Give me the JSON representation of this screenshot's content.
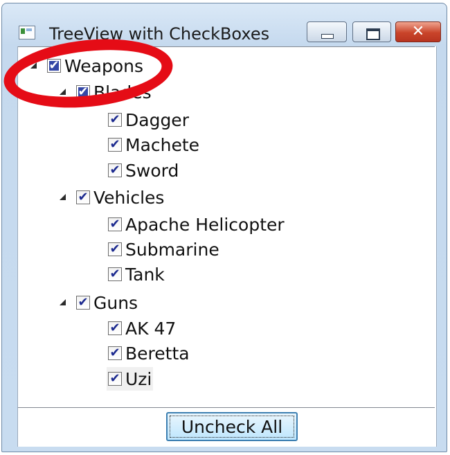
{
  "window": {
    "title": "TreeView with CheckBoxes",
    "controls": {
      "minimize": "",
      "maximize": "",
      "close": "✕"
    }
  },
  "tree": {
    "root": {
      "label": "Weapons",
      "checked": true,
      "expanded": true
    },
    "groups": [
      {
        "label": "Blades",
        "checked": true,
        "expanded": true,
        "items": [
          {
            "label": "Dagger",
            "checked": true
          },
          {
            "label": "Machete",
            "checked": true
          },
          {
            "label": "Sword",
            "checked": true
          }
        ]
      },
      {
        "label": "Vehicles",
        "checked": true,
        "expanded": true,
        "items": [
          {
            "label": "Apache Helicopter",
            "checked": true
          },
          {
            "label": "Submarine",
            "checked": true
          },
          {
            "label": "Tank",
            "checked": true
          }
        ]
      },
      {
        "label": "Guns",
        "checked": true,
        "expanded": true,
        "items": [
          {
            "label": "AK 47",
            "checked": true
          },
          {
            "label": "Beretta",
            "checked": true
          },
          {
            "label": "Uzi",
            "checked": true
          }
        ]
      }
    ],
    "check_glyph": "✔"
  },
  "footer": {
    "uncheck_all_label": "Uncheck All"
  },
  "colors": {
    "annotation_ring": "#e50c16",
    "check_fill": "#3447a6",
    "button_border": "#3c7fb1"
  }
}
